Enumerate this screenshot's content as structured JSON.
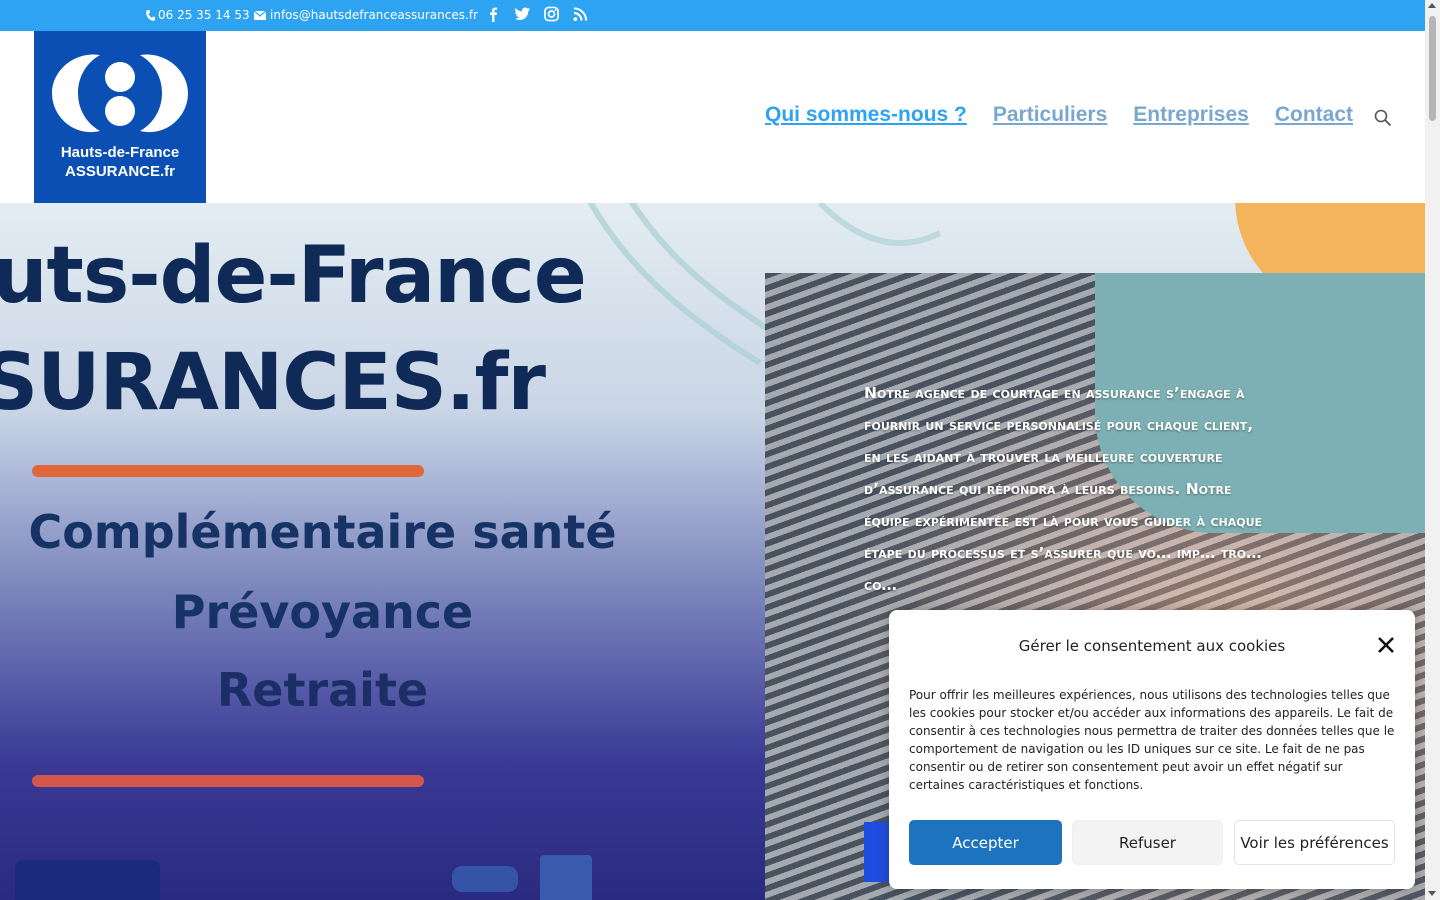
{
  "topbar": {
    "phone": "06 25 35 14 53",
    "email": "infos@hautsdefranceassurances.fr",
    "social": [
      "facebook-icon",
      "twitter-icon",
      "instagram-icon",
      "rss-icon"
    ],
    "bg_color": "#2ea3f2"
  },
  "header": {
    "logo_line1": "Hauts-de-France",
    "logo_line2": "ASSURANCE.fr",
    "logo_bg": "#0b4fb4",
    "nav": [
      {
        "label": "Qui sommes-nous ?",
        "active": true
      },
      {
        "label": "Particuliers",
        "active": false
      },
      {
        "label": "Entreprises",
        "active": false
      },
      {
        "label": "Contact",
        "active": false
      }
    ]
  },
  "hero": {
    "title_line1": "uts-de-France",
    "title_line2": "SURANCES.fr",
    "product1": "Complémentaire santé",
    "product2": "Prévoyance",
    "product3": "Retraite",
    "paragraph": "Notre agence de courtage en assurance s’engage à fournir un service personnalisé pour chaque client, en les aidant à trouver la meilleure couverture d’assurance qui répondra à leurs besoins. Notre équipe expérimentée est là pour vous guider à chaque étape du processus et s’assurer que vo… imp… tro… co…"
  },
  "cookie": {
    "title": "Gérer le consentement aux cookies",
    "body": "Pour offrir les meilleures expériences, nous utilisons des technologies telles que les cookies pour stocker et/ou accéder aux informations des appareils. Le fait de consentir à ces technologies nous permettra de traiter des données telles que le comportement de navigation ou les ID uniques sur ce site. Le fait de ne pas consentir ou de retirer son consentement peut avoir un effet négatif sur certaines caractéristiques et fonctions.",
    "accept": "Accepter",
    "refuse": "Refuser",
    "preferences": "Voir les préférences",
    "accept_color": "#1e73be"
  }
}
